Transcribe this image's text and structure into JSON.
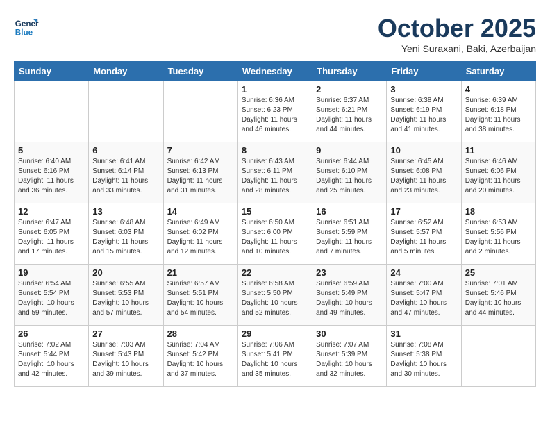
{
  "header": {
    "logo_line1": "General",
    "logo_line2": "Blue",
    "month": "October 2025",
    "location": "Yeni Suraxani, Baki, Azerbaijan"
  },
  "days_of_week": [
    "Sunday",
    "Monday",
    "Tuesday",
    "Wednesday",
    "Thursday",
    "Friday",
    "Saturday"
  ],
  "weeks": [
    [
      {
        "day": "",
        "text": ""
      },
      {
        "day": "",
        "text": ""
      },
      {
        "day": "",
        "text": ""
      },
      {
        "day": "1",
        "text": "Sunrise: 6:36 AM\nSunset: 6:23 PM\nDaylight: 11 hours\nand 46 minutes."
      },
      {
        "day": "2",
        "text": "Sunrise: 6:37 AM\nSunset: 6:21 PM\nDaylight: 11 hours\nand 44 minutes."
      },
      {
        "day": "3",
        "text": "Sunrise: 6:38 AM\nSunset: 6:19 PM\nDaylight: 11 hours\nand 41 minutes."
      },
      {
        "day": "4",
        "text": "Sunrise: 6:39 AM\nSunset: 6:18 PM\nDaylight: 11 hours\nand 38 minutes."
      }
    ],
    [
      {
        "day": "5",
        "text": "Sunrise: 6:40 AM\nSunset: 6:16 PM\nDaylight: 11 hours\nand 36 minutes."
      },
      {
        "day": "6",
        "text": "Sunrise: 6:41 AM\nSunset: 6:14 PM\nDaylight: 11 hours\nand 33 minutes."
      },
      {
        "day": "7",
        "text": "Sunrise: 6:42 AM\nSunset: 6:13 PM\nDaylight: 11 hours\nand 31 minutes."
      },
      {
        "day": "8",
        "text": "Sunrise: 6:43 AM\nSunset: 6:11 PM\nDaylight: 11 hours\nand 28 minutes."
      },
      {
        "day": "9",
        "text": "Sunrise: 6:44 AM\nSunset: 6:10 PM\nDaylight: 11 hours\nand 25 minutes."
      },
      {
        "day": "10",
        "text": "Sunrise: 6:45 AM\nSunset: 6:08 PM\nDaylight: 11 hours\nand 23 minutes."
      },
      {
        "day": "11",
        "text": "Sunrise: 6:46 AM\nSunset: 6:06 PM\nDaylight: 11 hours\nand 20 minutes."
      }
    ],
    [
      {
        "day": "12",
        "text": "Sunrise: 6:47 AM\nSunset: 6:05 PM\nDaylight: 11 hours\nand 17 minutes."
      },
      {
        "day": "13",
        "text": "Sunrise: 6:48 AM\nSunset: 6:03 PM\nDaylight: 11 hours\nand 15 minutes."
      },
      {
        "day": "14",
        "text": "Sunrise: 6:49 AM\nSunset: 6:02 PM\nDaylight: 11 hours\nand 12 minutes."
      },
      {
        "day": "15",
        "text": "Sunrise: 6:50 AM\nSunset: 6:00 PM\nDaylight: 11 hours\nand 10 minutes."
      },
      {
        "day": "16",
        "text": "Sunrise: 6:51 AM\nSunset: 5:59 PM\nDaylight: 11 hours\nand 7 minutes."
      },
      {
        "day": "17",
        "text": "Sunrise: 6:52 AM\nSunset: 5:57 PM\nDaylight: 11 hours\nand 5 minutes."
      },
      {
        "day": "18",
        "text": "Sunrise: 6:53 AM\nSunset: 5:56 PM\nDaylight: 11 hours\nand 2 minutes."
      }
    ],
    [
      {
        "day": "19",
        "text": "Sunrise: 6:54 AM\nSunset: 5:54 PM\nDaylight: 10 hours\nand 59 minutes."
      },
      {
        "day": "20",
        "text": "Sunrise: 6:55 AM\nSunset: 5:53 PM\nDaylight: 10 hours\nand 57 minutes."
      },
      {
        "day": "21",
        "text": "Sunrise: 6:57 AM\nSunset: 5:51 PM\nDaylight: 10 hours\nand 54 minutes."
      },
      {
        "day": "22",
        "text": "Sunrise: 6:58 AM\nSunset: 5:50 PM\nDaylight: 10 hours\nand 52 minutes."
      },
      {
        "day": "23",
        "text": "Sunrise: 6:59 AM\nSunset: 5:49 PM\nDaylight: 10 hours\nand 49 minutes."
      },
      {
        "day": "24",
        "text": "Sunrise: 7:00 AM\nSunset: 5:47 PM\nDaylight: 10 hours\nand 47 minutes."
      },
      {
        "day": "25",
        "text": "Sunrise: 7:01 AM\nSunset: 5:46 PM\nDaylight: 10 hours\nand 44 minutes."
      }
    ],
    [
      {
        "day": "26",
        "text": "Sunrise: 7:02 AM\nSunset: 5:44 PM\nDaylight: 10 hours\nand 42 minutes."
      },
      {
        "day": "27",
        "text": "Sunrise: 7:03 AM\nSunset: 5:43 PM\nDaylight: 10 hours\nand 39 minutes."
      },
      {
        "day": "28",
        "text": "Sunrise: 7:04 AM\nSunset: 5:42 PM\nDaylight: 10 hours\nand 37 minutes."
      },
      {
        "day": "29",
        "text": "Sunrise: 7:06 AM\nSunset: 5:41 PM\nDaylight: 10 hours\nand 35 minutes."
      },
      {
        "day": "30",
        "text": "Sunrise: 7:07 AM\nSunset: 5:39 PM\nDaylight: 10 hours\nand 32 minutes."
      },
      {
        "day": "31",
        "text": "Sunrise: 7:08 AM\nSunset: 5:38 PM\nDaylight: 10 hours\nand 30 minutes."
      },
      {
        "day": "",
        "text": ""
      }
    ]
  ]
}
